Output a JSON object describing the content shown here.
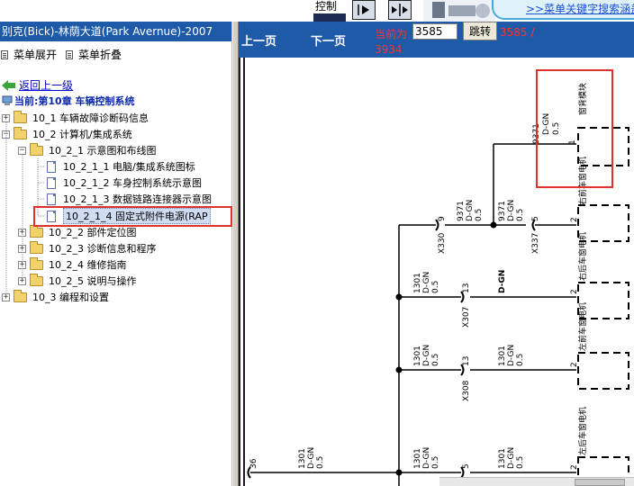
{
  "toolbar": {
    "control_label": "控制",
    "banner_link": ">>菜单关键字搜索涵盖"
  },
  "left_panel": {
    "title": "别克(Bick)-林荫大道(Park Avernue)-2007",
    "menu_expand": "菜单展开",
    "menu_collapse": "菜单折叠",
    "back_label": "返回上一级",
    "current_label": "当前:第10章 车辆控制系统",
    "tree": [
      {
        "label": "10_1 车辆故障诊断码信息"
      },
      {
        "label": "10_2 计算机/集成系统"
      },
      {
        "label": "10_2_1 示意图和布线图"
      },
      {
        "label": "10_2_1_1 电脑/集成系统图标"
      },
      {
        "label": "10_2_1_2 车身控制系统示意图"
      },
      {
        "label": "10_2_1_3 数据链路连接器示意图"
      },
      {
        "label": "10_2_1_4 固定式附件电源(RAP"
      },
      {
        "label": "10_2_2 部件定位图"
      },
      {
        "label": "10_2_3 诊断信息和程序"
      },
      {
        "label": "10_2_4 维修指南"
      },
      {
        "label": "10_2_5 说明与操作"
      },
      {
        "label": "10_3 编程和设置"
      }
    ]
  },
  "right_panel": {
    "prev_page": "上一页",
    "next_page": "下一页",
    "current_label": "当前为",
    "current_page_value": "3585",
    "go_button": "跳转",
    "page_status_a": "3585 /",
    "page_status_b": "3934"
  },
  "schematic": {
    "top_module": "窗背模块",
    "top_wire_id": "9371",
    "top_wire_color": "D-GN",
    "top_wire_size": "0.5",
    "top_pin": "1",
    "motor_rf": "右前车窗电机",
    "motor_rr": "右后车窗电机",
    "motor_lf": "左前车窗电机",
    "motor_lr": "左后车窗电机",
    "pin_2": "2",
    "wire_9371": "9371",
    "wire_1301": "1301",
    "color_dgn": "D-GN",
    "size_05": "0.5",
    "conn_x330": "X330",
    "conn_x337": "X337",
    "conn_x307": "X307",
    "conn_x308": "X308",
    "pin_9": "9",
    "pin_5": "5",
    "pin_13": "13",
    "pin_36": "36",
    "standalone_color": "D-GN"
  },
  "colors": {
    "header_blue": "#1e5aa8",
    "highlight_red": "#e0312a",
    "page_red": "#ff3030",
    "link_blue": "#0000cc"
  }
}
